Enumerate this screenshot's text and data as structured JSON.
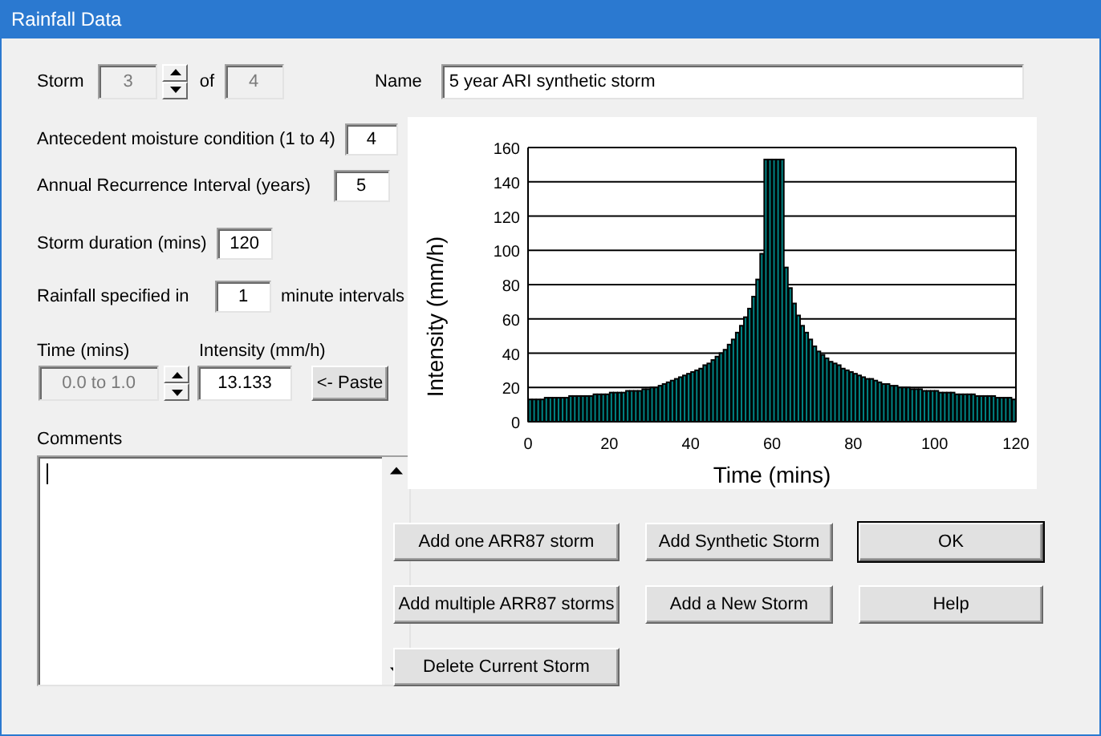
{
  "window": {
    "title": "Rainfall Data"
  },
  "storm": {
    "label": "Storm",
    "current": "3",
    "of_label": "of",
    "total": "4",
    "disabled": true
  },
  "name": {
    "label": "Name",
    "value": "5 year ARI synthetic storm"
  },
  "fields": [
    {
      "label": "Antecedent moisture condition (1 to 4)",
      "value": "4"
    },
    {
      "label": "Annual Recurrence Interval (years)",
      "value": "5"
    },
    {
      "label": "Storm duration (mins)",
      "value": "120"
    }
  ],
  "interval": {
    "label": "Rainfall specified in",
    "value": "1",
    "suffix": "minute intervals"
  },
  "time": {
    "label": "Time (mins)",
    "value": "0.0 to 1.0",
    "disabled": true
  },
  "intensity": {
    "label": "Intensity (mm/h)",
    "value": "13.133"
  },
  "paste_button": "<- Paste",
  "comments": {
    "label": "Comments"
  },
  "chart": {
    "chart_data": {
      "type": "bar",
      "xlabel": "Time (mins)",
      "ylabel": "Intensity (mm/h)",
      "xlim": [
        0,
        120
      ],
      "ylim": [
        0,
        160
      ],
      "xticks": [
        0,
        20,
        40,
        60,
        80,
        100,
        120
      ],
      "yticks": [
        0,
        20,
        40,
        60,
        80,
        100,
        120,
        140,
        160
      ],
      "grid": true,
      "x": [
        0.5,
        1.5,
        2.5,
        3.5,
        4.5,
        5.5,
        6.5,
        7.5,
        8.5,
        9.5,
        10.5,
        11.5,
        12.5,
        13.5,
        14.5,
        15.5,
        16.5,
        17.5,
        18.5,
        19.5,
        20.5,
        21.5,
        22.5,
        23.5,
        24.5,
        25.5,
        26.5,
        27.5,
        28.5,
        29.5,
        30.5,
        31.5,
        32.5,
        33.5,
        34.5,
        35.5,
        36.5,
        37.5,
        38.5,
        39.5,
        40.5,
        41.5,
        42.5,
        43.5,
        44.5,
        45.5,
        46.5,
        47.5,
        48.5,
        49.5,
        50.5,
        51.5,
        52.5,
        53.5,
        54.5,
        55.5,
        56.5,
        57.5,
        58.5,
        59.5,
        60.5,
        61.5,
        62.5,
        63.5,
        64.5,
        65.5,
        66.5,
        67.5,
        68.5,
        69.5,
        70.5,
        71.5,
        72.5,
        73.5,
        74.5,
        75.5,
        76.5,
        77.5,
        78.5,
        79.5,
        80.5,
        81.5,
        82.5,
        83.5,
        84.5,
        85.5,
        86.5,
        87.5,
        88.5,
        89.5,
        90.5,
        91.5,
        92.5,
        93.5,
        94.5,
        95.5,
        96.5,
        97.5,
        98.5,
        99.5,
        100.5,
        101.5,
        102.5,
        103.5,
        104.5,
        105.5,
        106.5,
        107.5,
        108.5,
        109.5,
        110.5,
        111.5,
        112.5,
        113.5,
        114.5,
        115.5,
        116.5,
        117.5,
        118.5,
        119.5
      ],
      "values": [
        13,
        13,
        13,
        13,
        14,
        14,
        14,
        14,
        14,
        14,
        15,
        15,
        15,
        15,
        15,
        15,
        16,
        16,
        16,
        16,
        17,
        17,
        17,
        17,
        18,
        18,
        18,
        18,
        19,
        19,
        20,
        20,
        21,
        22,
        23,
        24,
        25,
        26,
        27,
        28,
        29,
        30,
        31,
        33,
        34,
        36,
        38,
        40,
        42,
        45,
        48,
        52,
        56,
        61,
        66,
        73,
        83,
        98,
        153,
        153,
        153,
        153,
        153,
        90,
        78,
        69,
        62,
        56,
        52,
        48,
        44,
        41,
        39,
        37,
        35,
        34,
        33,
        31,
        30,
        29,
        28,
        27,
        26,
        25,
        25,
        24,
        23,
        22,
        22,
        21,
        21,
        20,
        20,
        20,
        19,
        19,
        19,
        18,
        18,
        18,
        18,
        17,
        17,
        17,
        17,
        16,
        16,
        16,
        16,
        16,
        15,
        15,
        15,
        15,
        15,
        14,
        14,
        14,
        14,
        13
      ]
    }
  },
  "buttons": [
    {
      "label": "Add one ARR87 storm",
      "default": false
    },
    {
      "label": "Add Synthetic Storm",
      "default": false
    },
    {
      "label": "OK",
      "default": true
    },
    {
      "label": "Add multiple ARR87 storms",
      "default": false
    },
    {
      "label": "Add a New Storm",
      "default": false
    },
    {
      "label": "Help",
      "default": false
    },
    {
      "label": "Delete Current Storm",
      "default": false
    }
  ]
}
